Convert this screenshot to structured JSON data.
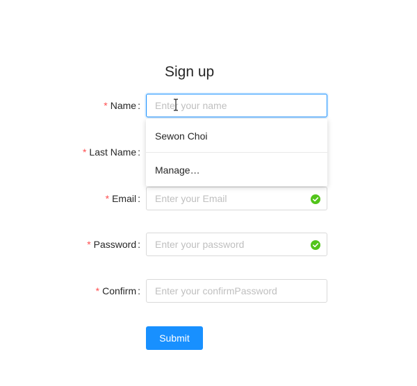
{
  "form": {
    "title": "Sign up",
    "fields": {
      "name": {
        "label": "Name",
        "placeholder": "Enter your name",
        "value": ""
      },
      "last_name": {
        "label": "Last Name"
      },
      "email": {
        "label": "Email",
        "placeholder": "Enter your Email",
        "value": ""
      },
      "password": {
        "label": "Password",
        "placeholder": "Enter your password",
        "value": ""
      },
      "confirm": {
        "label": "Confirm",
        "placeholder": "Enter your confirmPassword",
        "value": ""
      }
    },
    "required_mark": "*",
    "colon": ":",
    "submit_label": "Submit"
  },
  "autocomplete": {
    "items": [
      "Sewon Choi",
      "Manage…"
    ]
  },
  "colors": {
    "primary": "#1890ff",
    "required": "#ff4d4f",
    "success": "#52c41a",
    "placeholder": "#bfbfbf",
    "border": "#d9d9d9"
  },
  "icons": {
    "validation": "check-circle-icon",
    "pointer": "text-cursor-icon"
  }
}
